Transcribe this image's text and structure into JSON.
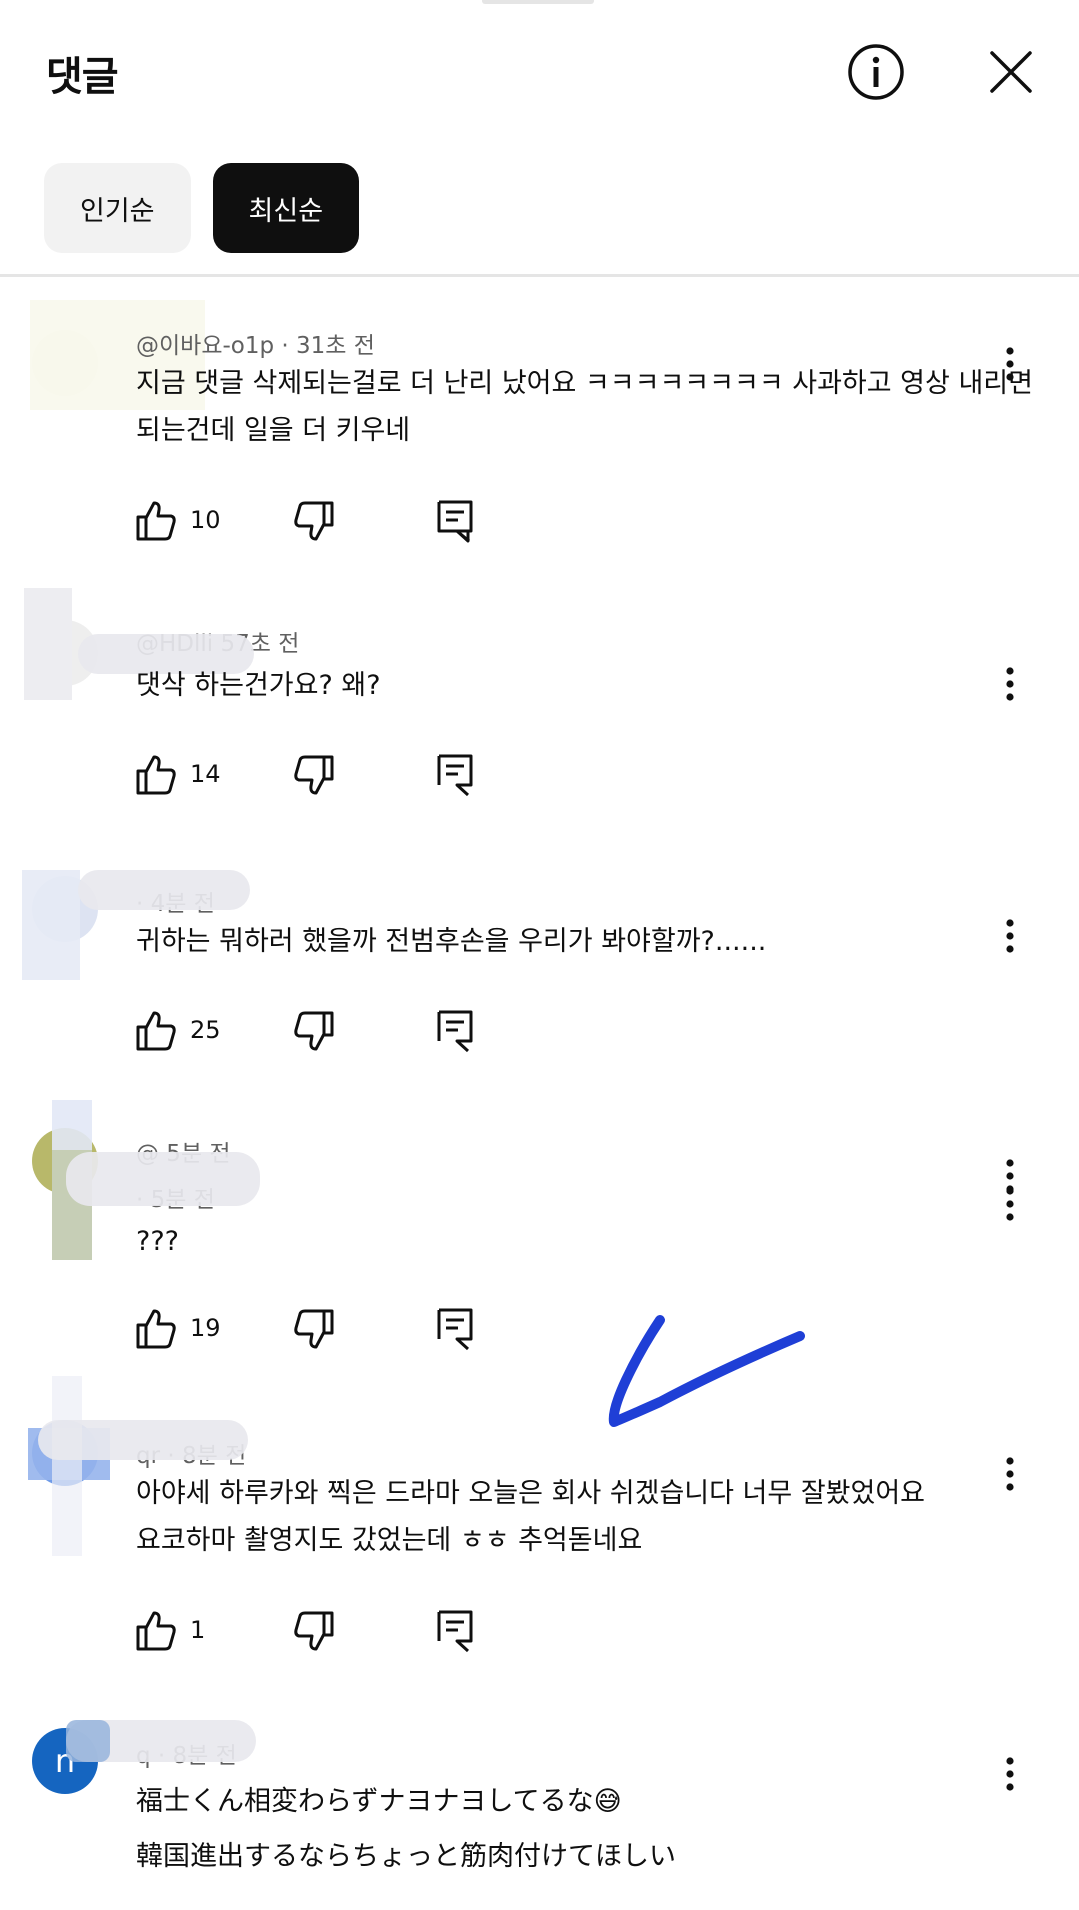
{
  "header": {
    "title": "댓글"
  },
  "sort": {
    "popular_label": "인기순",
    "latest_label": "최신순"
  },
  "comments": [
    {
      "meta": "@이바요-o1p · 31초 전",
      "lines": [
        "지금 댓글 삭제되는걸로 더 난리 났어요 ㅋㅋㅋㅋㅋㅋㅋㅋ  사과하고 영상 내리면",
        "되는건데 일을 더 키우네"
      ],
      "likes": "10"
    },
    {
      "meta": "@HDlli       57초 전",
      "lines": [
        "댓삭 하는건가요? 왜?"
      ],
      "likes": "14"
    },
    {
      "meta": "              · 4분 전",
      "lines": [
        "귀하는 뭐하러 했을까 전범후손을 우리가 봐야할까?......"
      ],
      "likes": "25"
    },
    {
      "meta": "@               5분 전",
      "meta2": "              · 5분 전",
      "lines": [
        "???"
      ],
      "likes": "19"
    },
    {
      "meta": "              qr · 8분 전",
      "lines": [
        "아야세 하루카와 찍은 드라마 오늘은 회사 쉬겠습니다 너무 잘봤었어요",
        "요코하마 촬영지도 갔었는데 ㅎㅎ 추억돋네요"
      ],
      "likes": "1"
    },
    {
      "avatar_letter": "n",
      "meta": "              q · 8분 전",
      "lines": [
        "福士くん相変わらずナヨナヨしてるな😅",
        "韓国進出するならちょっと筋肉付けてほしい"
      ],
      "likes": ""
    }
  ]
}
